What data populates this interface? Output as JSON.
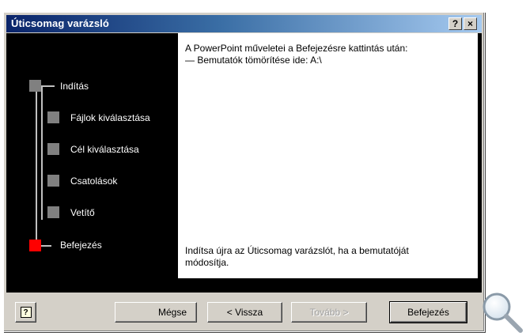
{
  "window": {
    "title": "Úticsomag varázsló",
    "help_glyph": "?",
    "close_glyph": "×"
  },
  "steps": [
    {
      "label": "Indítás",
      "state": "done"
    },
    {
      "label": "Fájlok kiválasztása",
      "state": "done"
    },
    {
      "label": "Cél kiválasztása",
      "state": "done"
    },
    {
      "label": "Csatolások",
      "state": "done"
    },
    {
      "label": "Vetítő",
      "state": "done"
    },
    {
      "label": "Befejezés",
      "state": "current"
    }
  ],
  "content": {
    "info_line1": "A PowerPoint műveletei a Befejezésre kattintás után:",
    "info_line2": "— Bemutatók tömörítése ide: A:\\",
    "footer_note": "Indítsa újra az Úticsomag varázslót, ha a bemutatóját módosítja."
  },
  "buttons": {
    "help_glyph": "?",
    "cancel": "Mégse",
    "back": "< Vissza",
    "next": "Tovább >",
    "finish": "Befejezés"
  },
  "colors": {
    "title_bar_start": "#0a246a",
    "title_bar_end": "#a6caf0",
    "step_done": "#808080",
    "step_current": "#ff0000",
    "panel_left": "#000000",
    "panel_right": "#ffffff"
  },
  "icons": {
    "magnifier": "magnifier-icon"
  }
}
